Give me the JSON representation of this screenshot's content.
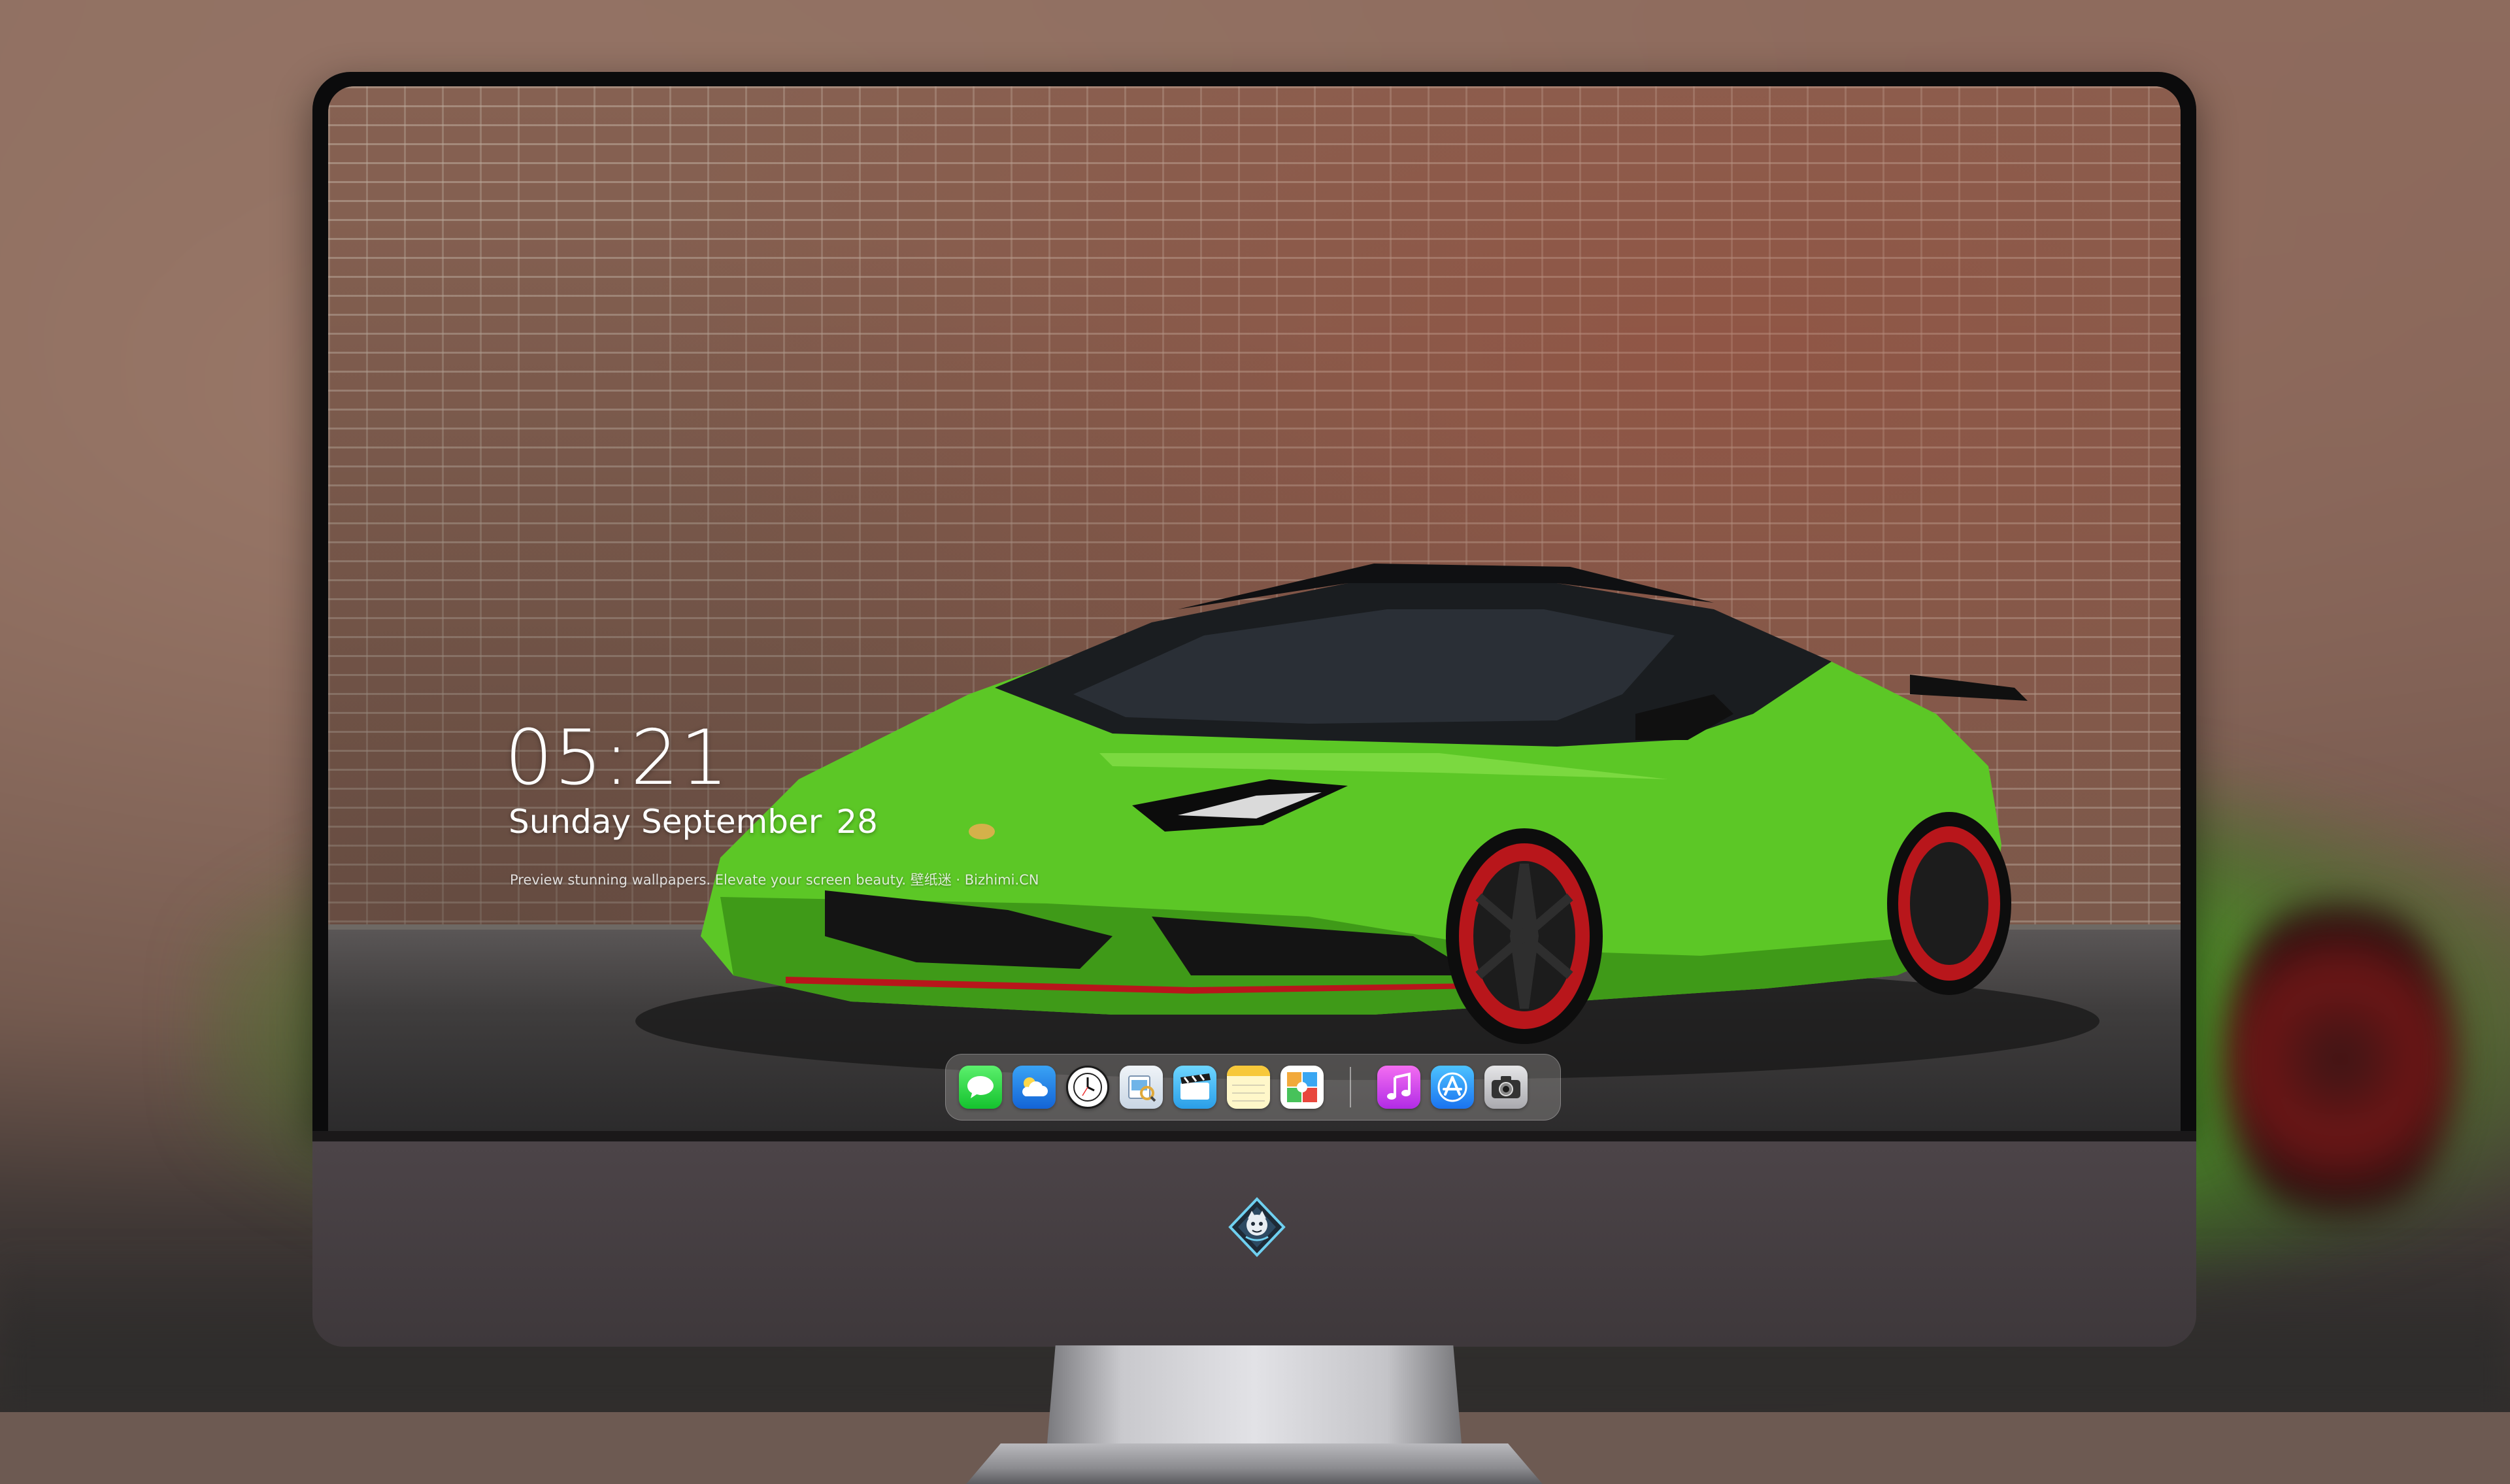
{
  "lock_screen": {
    "time": "05:21",
    "date_text": "Sunday September",
    "day_number": "28",
    "tagline": "Preview stunning wallpapers. Elevate your screen beauty. 壁纸迷 · Bizhimi.CN"
  },
  "dock": {
    "items": [
      {
        "name": "messages-icon",
        "label": "Messages"
      },
      {
        "name": "weather-icon",
        "label": "Weather"
      },
      {
        "name": "clock-icon",
        "label": "Clock"
      },
      {
        "name": "preview-icon",
        "label": "Preview"
      },
      {
        "name": "video-icon",
        "label": "Video"
      },
      {
        "name": "notes-icon",
        "label": "Notes"
      },
      {
        "name": "photos-icon",
        "label": "Photos"
      },
      {
        "name": "music-icon",
        "label": "Music"
      },
      {
        "name": "app-store-icon",
        "label": "App Store"
      },
      {
        "name": "camera-icon",
        "label": "Camera"
      }
    ]
  },
  "colors": {
    "car_green": "#5cc726",
    "wheel_red": "#b8161b",
    "brick": "#8d6656",
    "bezel": "#0b0b0c",
    "chin": "#453f42"
  },
  "chin_logo": {
    "name": "bizhimi-logo-icon"
  }
}
